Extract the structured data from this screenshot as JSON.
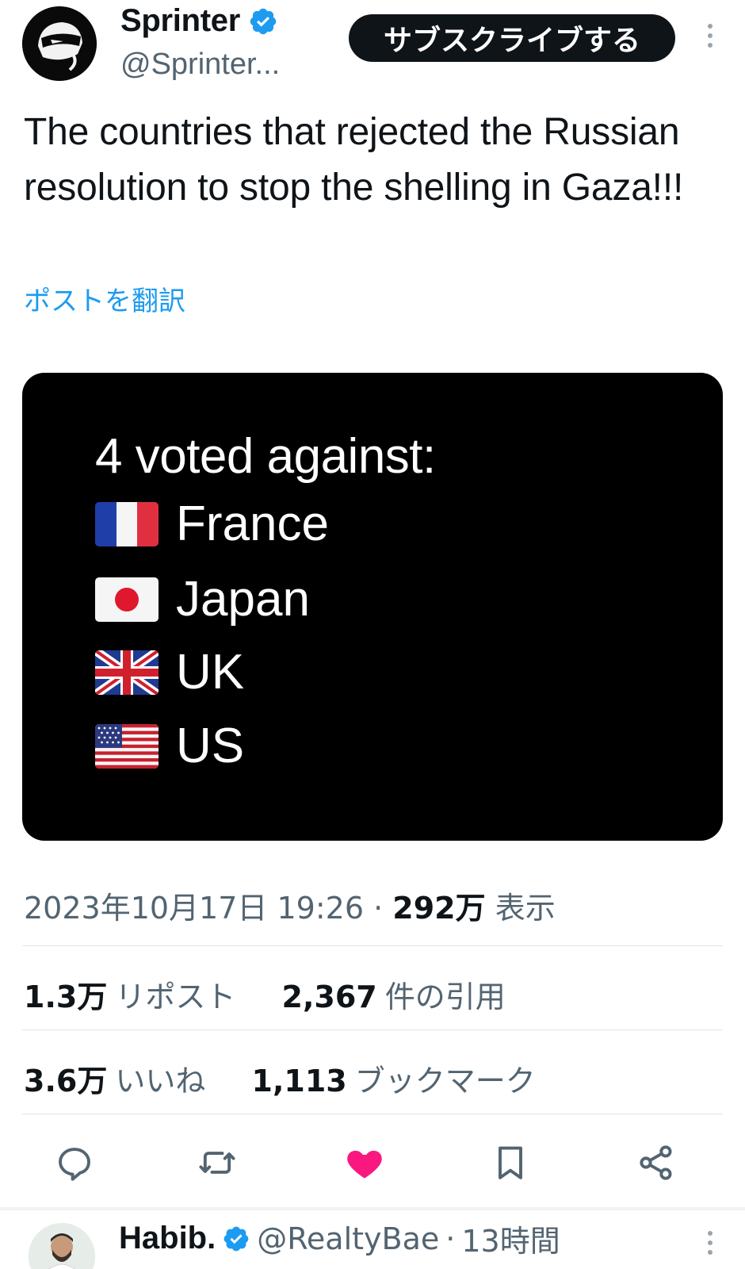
{
  "author": {
    "name": "Sprinter",
    "handle": "@Sprinter...",
    "subscribe_label": "サブスクライブする"
  },
  "tweet": {
    "text": "The countries that rejected the Russian resolution to stop the shelling  in Gaza!!!",
    "translate_label": "ポストを翻訳"
  },
  "media": {
    "title": "4 voted against:",
    "countries": [
      {
        "name": "France",
        "flag": "flag-france"
      },
      {
        "name": "Japan",
        "flag": "flag-japan"
      },
      {
        "name": "UK",
        "flag": "flag-uk"
      },
      {
        "name": "US",
        "flag": "flag-us"
      }
    ]
  },
  "meta": {
    "datetime": "2023年10月17日 19:26",
    "separator": "·",
    "views_count": "292万",
    "views_label": "表示"
  },
  "stats": {
    "reposts_count": "1.3万",
    "reposts_label": "リポスト",
    "quotes_count": "2,367",
    "quotes_label": "件の引用",
    "likes_count": "3.6万",
    "likes_label": "いいね",
    "bookmarks_count": "1,113",
    "bookmarks_label": "ブックマーク"
  },
  "actions": [
    "reply-icon",
    "repost-icon",
    "like-icon",
    "bookmark-icon",
    "share-icon"
  ],
  "colors": {
    "accent": "#1d9bf0",
    "like": "#f91880",
    "muted": "#536471"
  },
  "reply": {
    "name": "Habib.",
    "handle": "@RealtyBae",
    "separator": "·",
    "time": "13時間"
  }
}
